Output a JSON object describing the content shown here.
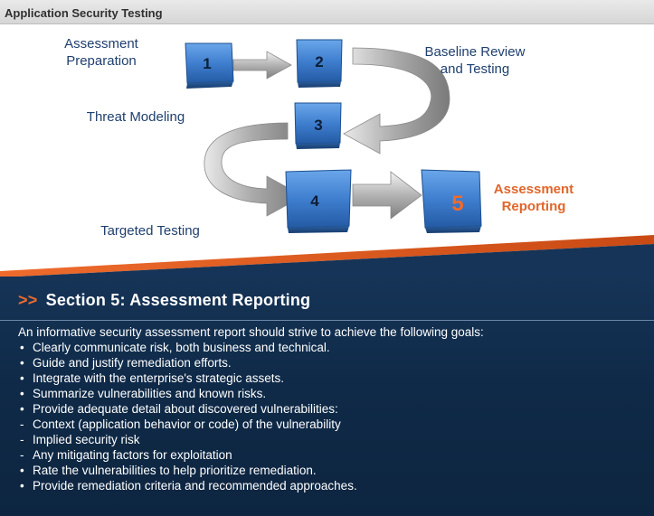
{
  "header": {
    "title": "Application Security Testing"
  },
  "diagram": {
    "steps": [
      {
        "number": "1",
        "label": "Assessment\nPreparation"
      },
      {
        "number": "2",
        "label": "Baseline Review\nand Testing"
      },
      {
        "number": "3",
        "label": "Threat Modeling"
      },
      {
        "number": "4",
        "label": "Targeted Testing"
      },
      {
        "number": "5",
        "label": "Assessment\nReporting"
      }
    ],
    "active_step": 5,
    "colors": {
      "box": "#3f7fcf",
      "active": "#e0662a",
      "arrow": "#9a9a9a",
      "label": "#1f3f6e"
    }
  },
  "section": {
    "chevron": ">>",
    "title": "Section 5: Assessment Reporting",
    "intro": "An informative security assessment report should strive to achieve the following goals:",
    "items": [
      {
        "marker": "•",
        "text": "Clearly communicate risk, both business and technical."
      },
      {
        "marker": "•",
        "text": "Guide and justify remediation efforts."
      },
      {
        "marker": "•",
        "text": "Integrate with the enterprise's strategic assets."
      },
      {
        "marker": "•",
        "text": "Summarize vulnerabilities and known risks."
      },
      {
        "marker": "•",
        "text": "Provide adequate detail about discovered vulnerabilities:"
      },
      {
        "marker": "-",
        "text": "Context (application behavior or code) of the vulnerability",
        "sub": true
      },
      {
        "marker": "-",
        "text": "Implied security risk",
        "sub": true
      },
      {
        "marker": "-",
        "text": "Any mitigating factors for exploitation",
        "sub": true
      },
      {
        "marker": "•",
        "text": "Rate the vulnerabilities to help prioritize remediation."
      },
      {
        "marker": "•",
        "text": "Provide remediation criteria and recommended approaches."
      }
    ]
  }
}
